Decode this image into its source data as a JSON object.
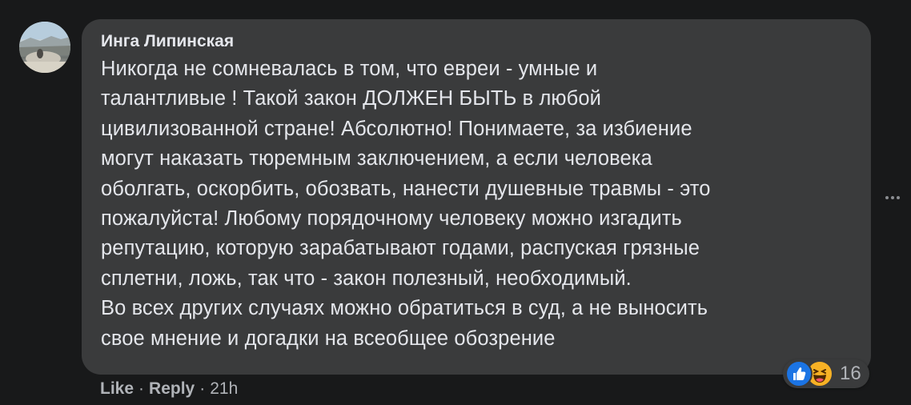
{
  "comment": {
    "author": "Инга Липинская",
    "text_lines": [
      "Никогда не сомневалась в том, что евреи - умные и",
      "талантливые ! Такой закон ДОЛЖЕН БЫТЬ в любой",
      "цивилизованной стране! Абсолютно! Понимаете, за избиение",
      "могут наказать тюремным заключением, а если человека",
      "оболгать, оскорбить, обозвать, нанести душевные травмы - это",
      "пожалуйста! Любому порядочному человеку можно изгадить",
      "репутацию, которую зарабатывают годами, распуская грязные",
      "сплетни, ложь, так что - закон полезный, необходимый.",
      "Во всех других случаях можно обратиться в суд, а не выносить",
      "свое мнение и догадки на всеобщее обозрение"
    ],
    "actions": {
      "like_label": "Like",
      "separator": "·",
      "reply_label": "Reply",
      "time": "21h"
    },
    "reactions": {
      "icons": [
        "like-icon",
        "haha-icon"
      ],
      "count": "16",
      "like_color": "#1b74e4",
      "haha_color": "#f7b125"
    }
  },
  "colors": {
    "background": "#18191a",
    "bubble": "#3a3b3c",
    "text_primary": "#e4e6eb",
    "text_secondary": "#b0b3b8"
  }
}
